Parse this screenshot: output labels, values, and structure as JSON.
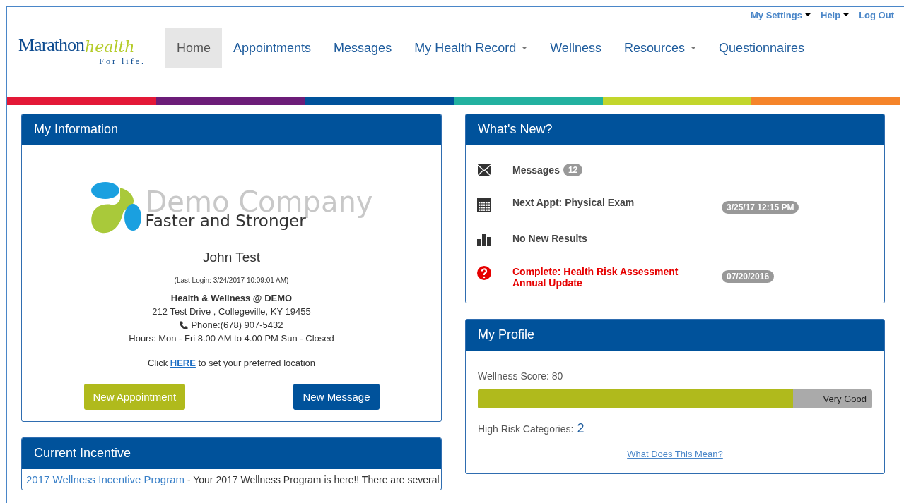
{
  "top_links": [
    {
      "label": "My Settings",
      "dropdown": true
    },
    {
      "label": "Help",
      "dropdown": true
    },
    {
      "label": "Log Out",
      "dropdown": false
    }
  ],
  "logo": {
    "word": "Marathon",
    "script": "health",
    "tagline": "For life."
  },
  "nav": [
    {
      "label": "Home",
      "selected": true,
      "dropdown": false
    },
    {
      "label": "Appointments",
      "selected": false,
      "dropdown": false
    },
    {
      "label": "Messages",
      "selected": false,
      "dropdown": false
    },
    {
      "label": "My Health Record",
      "selected": false,
      "dropdown": true
    },
    {
      "label": "Wellness",
      "selected": false,
      "dropdown": false
    },
    {
      "label": "Resources",
      "selected": false,
      "dropdown": true
    },
    {
      "label": "Questionnaires",
      "selected": false,
      "dropdown": false
    }
  ],
  "my_information": {
    "title": "My Information",
    "company": {
      "name": "Demo Company",
      "slogan": "Faster and Stronger"
    },
    "user_name": "John Test",
    "last_login": "(Last Login: 3/24/2017 10:09:01 AM)",
    "location_name": "Health & Wellness @ DEMO",
    "address": "212 Test Drive , Collegeville, KY 19455",
    "phone": "Phone:(678) 907-5432",
    "hours": "Hours: Mon - Fri 8.00 AM to 4.00 PM Sun - Closed",
    "preferred_before": "Click",
    "preferred_link": "HERE",
    "preferred_after": "to set your preferred location",
    "buttons": [
      {
        "label": "New Appointment",
        "kind": "primary"
      },
      {
        "label": "New Message",
        "kind": "secondary"
      }
    ]
  },
  "current_incentive": {
    "title": "Current Incentive",
    "link": "2017 Wellness Incentive Program",
    "text": "- Your 2017 Wellness Program is here!! There are several"
  },
  "whats_new": {
    "title": "What's New?",
    "items": [
      {
        "kind": "messages",
        "text": "Messages",
        "count": "12",
        "urgent": false
      },
      {
        "kind": "appointment",
        "text": "Next Appt: Physical Exam",
        "date": "3/25/17 12:15 PM",
        "urgent": false
      },
      {
        "kind": "results",
        "text": "No New Results",
        "urgent": false
      },
      {
        "kind": "alert",
        "text": "Complete: Health Risk Assessment Annual Update",
        "date": "07/20/2016",
        "urgent": true
      }
    ]
  },
  "my_profile": {
    "title": "My Profile",
    "wellness_score": "Wellness Score: 80",
    "level": 0.8,
    "rating": "Very Good",
    "high_risk_label": "High Risk Categories:",
    "high_risk_count": "2",
    "link": "What Does This Mean?"
  }
}
